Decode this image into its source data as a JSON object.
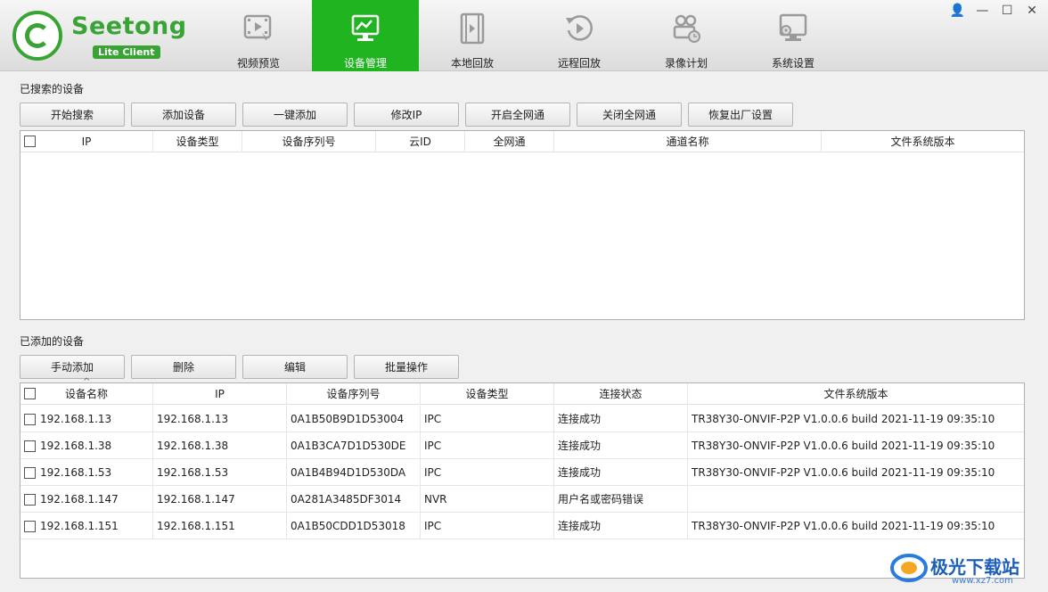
{
  "app": {
    "logo_name": "Seetong",
    "logo_sub": "Lite Client"
  },
  "nav": {
    "tabs": [
      {
        "label": "视频预览",
        "icon": "video-preview-icon"
      },
      {
        "label": "设备管理",
        "icon": "device-manage-icon",
        "active": true
      },
      {
        "label": "本地回放",
        "icon": "film-icon"
      },
      {
        "label": "远程回放",
        "icon": "replay-icon"
      },
      {
        "label": "录像计划",
        "icon": "camera-schedule-icon"
      },
      {
        "label": "系统设置",
        "icon": "system-settings-icon"
      }
    ]
  },
  "window": {
    "user": "👤",
    "minimize": "—",
    "maximize": "☐",
    "close": "✕"
  },
  "searched": {
    "title": "已搜索的设备",
    "buttons": [
      "开始搜索",
      "添加设备",
      "一键添加",
      "修改IP",
      "开启全网通",
      "关闭全网通",
      "恢复出厂设置"
    ],
    "columns": [
      "IP",
      "设备类型",
      "设备序列号",
      "云ID",
      "全网通",
      "通道名称",
      "文件系统版本"
    ]
  },
  "added": {
    "title": "已添加的设备",
    "buttons": [
      "手动添加",
      "删除",
      "编辑",
      "批量操作"
    ],
    "columns": [
      "设备名称",
      "IP",
      "设备序列号",
      "设备类型",
      "连接状态",
      "文件系统版本"
    ],
    "sort_indicator": "^",
    "rows": [
      [
        "192.168.1.13",
        "192.168.1.13",
        "0A1B50B9D1D53004",
        "IPC",
        "连接成功",
        "TR38Y30-ONVIF-P2P V1.0.0.6 build 2021-11-19 09:35:10"
      ],
      [
        "192.168.1.38",
        "192.168.1.38",
        "0A1B3CA7D1D530DE",
        "IPC",
        "连接成功",
        "TR38Y30-ONVIF-P2P V1.0.0.6 build 2021-11-19 09:35:10"
      ],
      [
        "192.168.1.53",
        "192.168.1.53",
        "0A1B4B94D1D530DA",
        "IPC",
        "连接成功",
        "TR38Y30-ONVIF-P2P V1.0.0.6 build 2021-11-19 09:35:10"
      ],
      [
        "192.168.1.147",
        "192.168.1.147",
        "0A281A3485DF3014",
        "NVR",
        "用户名或密码错误",
        ""
      ],
      [
        "192.168.1.151",
        "192.168.1.151",
        "0A1B50CDD1D53018",
        "IPC",
        "连接成功",
        "TR38Y30-ONVIF-P2P V1.0.0.6 build 2021-11-19 09:35:10"
      ]
    ]
  },
  "watermark": {
    "text": "极光下载站",
    "url": "www.xz7.com"
  },
  "colors": {
    "brand": "#3aa335",
    "active_tab": "#1fb420"
  }
}
